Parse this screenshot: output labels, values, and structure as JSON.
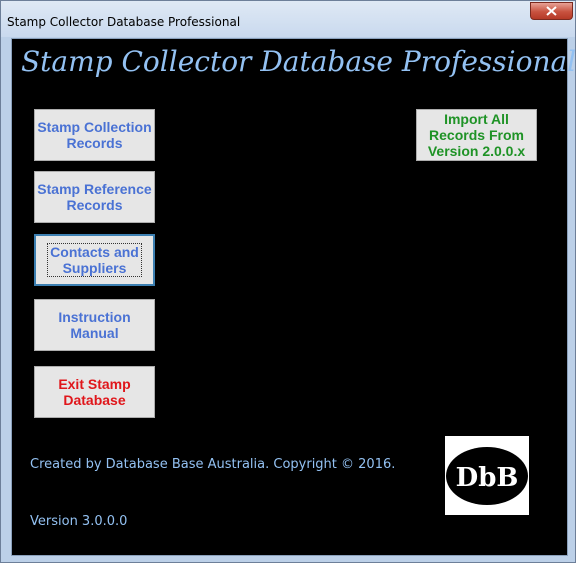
{
  "window": {
    "title": "Stamp Collector Database Professional",
    "close_icon": "close-icon"
  },
  "app": {
    "heading": "Stamp Collector Database Professional",
    "buttons": [
      {
        "label_line1": "Stamp Collection",
        "label_line2": "Records"
      },
      {
        "label_line1": "Stamp Reference",
        "label_line2": "Records"
      },
      {
        "label_line1": "Contacts and",
        "label_line2": "Suppliers"
      },
      {
        "label_line1": "Instruction",
        "label_line2": "Manual"
      },
      {
        "label_line1": "Exit Stamp",
        "label_line2": "Database"
      }
    ],
    "import_button": {
      "line1": "Import All",
      "line2": "Records From",
      "line3": "Version 2.0.0.x"
    },
    "credit": "Created by Database Base Australia.  Copyright © 2016.",
    "version": "Version 3.0.0.0",
    "logo_text": "DbB"
  },
  "colors": {
    "background": "#000000",
    "title_text": "#93c1f2",
    "button_text": "#4a72d4",
    "exit_text": "#e0161b",
    "import_text": "#1f9326",
    "button_face": "#e6e6e6"
  }
}
